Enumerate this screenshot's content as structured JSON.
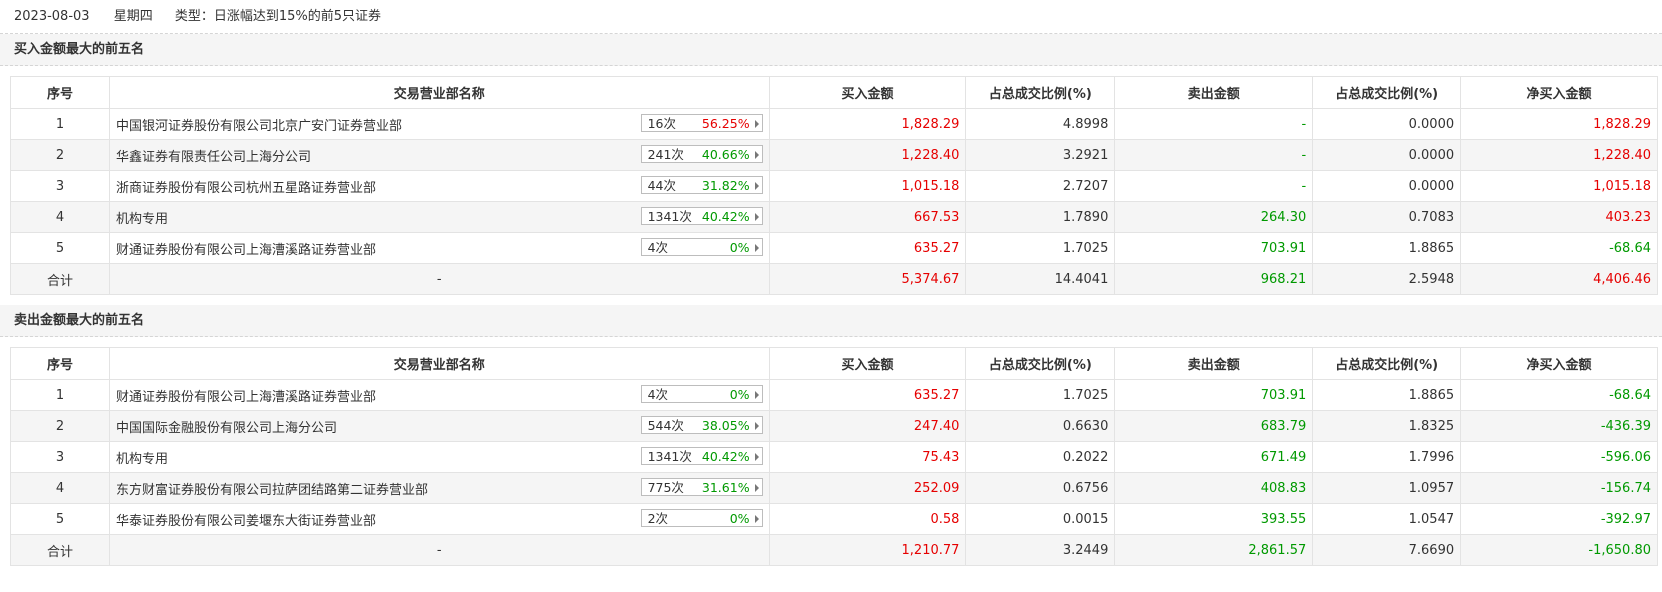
{
  "header": {
    "date": "2023-08-03",
    "weekday": "星期四",
    "type_label": "类型：",
    "type_value": "日涨幅达到15%的前5只证券"
  },
  "columns": [
    "序号",
    "交易营业部名称",
    "买入金额",
    "占总成交比例(%)",
    "卖出金额",
    "占总成交比例(%)",
    "净买入金额"
  ],
  "colors": {
    "up": "#e60000",
    "down": "#009900"
  },
  "buy_section": {
    "title": "买入金额最大的前五名",
    "rows": [
      {
        "idx": "1",
        "name": "中国银河证券股份有限公司北京广安门证券营业部",
        "count": "16次",
        "rate": "56.25%",
        "rate_color": "red",
        "buy": "1,828.29",
        "buy_pct": "4.8998",
        "sell": "-",
        "sell_pct": "0.0000",
        "net": "1,828.29",
        "net_color": "red"
      },
      {
        "idx": "2",
        "name": "华鑫证券有限责任公司上海分公司",
        "count": "241次",
        "rate": "40.66%",
        "rate_color": "green",
        "buy": "1,228.40",
        "buy_pct": "3.2921",
        "sell": "-",
        "sell_pct": "0.0000",
        "net": "1,228.40",
        "net_color": "red"
      },
      {
        "idx": "3",
        "name": "浙商证券股份有限公司杭州五星路证券营业部",
        "count": "44次",
        "rate": "31.82%",
        "rate_color": "green",
        "buy": "1,015.18",
        "buy_pct": "2.7207",
        "sell": "-",
        "sell_pct": "0.0000",
        "net": "1,015.18",
        "net_color": "red"
      },
      {
        "idx": "4",
        "name": "机构专用",
        "count": "1341次",
        "rate": "40.42%",
        "rate_color": "green",
        "buy": "667.53",
        "buy_pct": "1.7890",
        "sell": "264.30",
        "sell_pct": "0.7083",
        "net": "403.23",
        "net_color": "red"
      },
      {
        "idx": "5",
        "name": "财通证券股份有限公司上海漕溪路证券营业部",
        "count": "4次",
        "rate": "0%",
        "rate_color": "green",
        "buy": "635.27",
        "buy_pct": "1.7025",
        "sell": "703.91",
        "sell_pct": "1.8865",
        "net": "-68.64",
        "net_color": "green"
      }
    ],
    "total": {
      "label": "合计",
      "name": "-",
      "buy": "5,374.67",
      "buy_pct": "14.4041",
      "sell": "968.21",
      "sell_pct": "2.5948",
      "net": "4,406.46",
      "net_color": "red"
    }
  },
  "sell_section": {
    "title": "卖出金额最大的前五名",
    "rows": [
      {
        "idx": "1",
        "name": "财通证券股份有限公司上海漕溪路证券营业部",
        "count": "4次",
        "rate": "0%",
        "rate_color": "green",
        "buy": "635.27",
        "buy_pct": "1.7025",
        "sell": "703.91",
        "sell_pct": "1.8865",
        "net": "-68.64",
        "net_color": "green"
      },
      {
        "idx": "2",
        "name": "中国国际金融股份有限公司上海分公司",
        "count": "544次",
        "rate": "38.05%",
        "rate_color": "green",
        "buy": "247.40",
        "buy_pct": "0.6630",
        "sell": "683.79",
        "sell_pct": "1.8325",
        "net": "-436.39",
        "net_color": "green"
      },
      {
        "idx": "3",
        "name": "机构专用",
        "count": "1341次",
        "rate": "40.42%",
        "rate_color": "green",
        "buy": "75.43",
        "buy_pct": "0.2022",
        "sell": "671.49",
        "sell_pct": "1.7996",
        "net": "-596.06",
        "net_color": "green"
      },
      {
        "idx": "4",
        "name": "东方财富证券股份有限公司拉萨团结路第二证券营业部",
        "count": "775次",
        "rate": "31.61%",
        "rate_color": "green",
        "buy": "252.09",
        "buy_pct": "0.6756",
        "sell": "408.83",
        "sell_pct": "1.0957",
        "net": "-156.74",
        "net_color": "green"
      },
      {
        "idx": "5",
        "name": "华泰证券股份有限公司姜堰东大街证券营业部",
        "count": "2次",
        "rate": "0%",
        "rate_color": "green",
        "buy": "0.58",
        "buy_pct": "0.0015",
        "sell": "393.55",
        "sell_pct": "1.0547",
        "net": "-392.97",
        "net_color": "green"
      }
    ],
    "total": {
      "label": "合计",
      "name": "-",
      "buy": "1,210.77",
      "buy_pct": "3.2449",
      "sell": "2,861.57",
      "sell_pct": "7.6690",
      "net": "-1,650.80",
      "net_color": "green"
    }
  }
}
